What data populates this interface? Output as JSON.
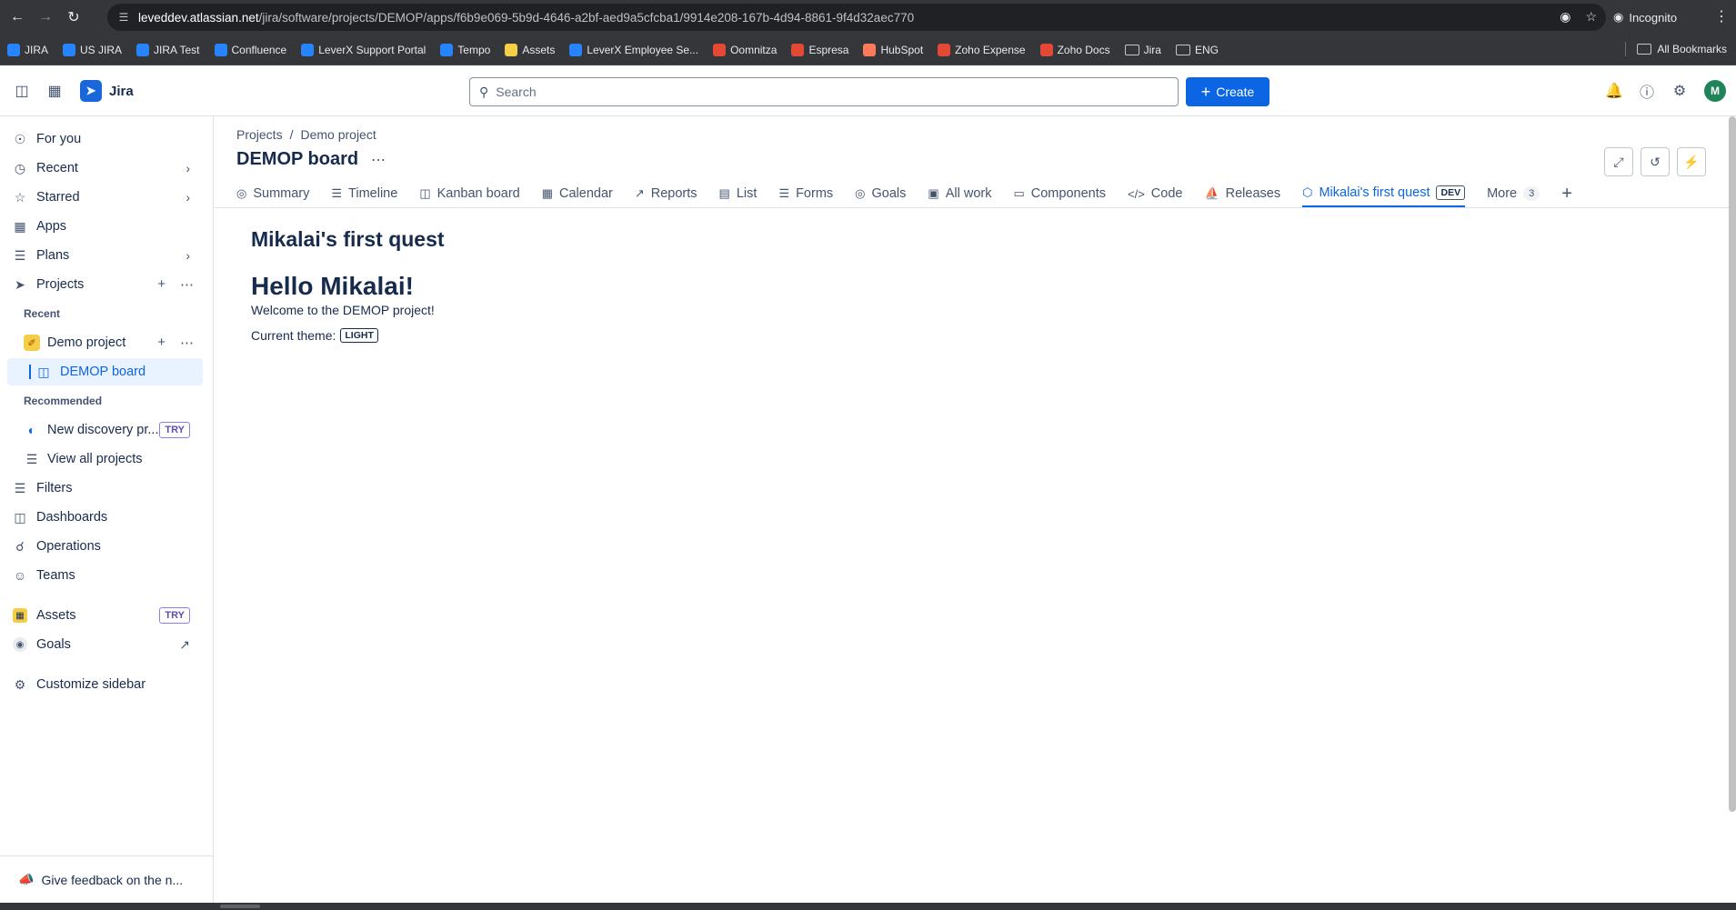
{
  "browser": {
    "url_host": "leveddev.atlassian.net",
    "url_path": "/jira/software/projects/DEMOP/apps/f6b9e069-5b9d-4646-a2bf-aed9a5cfcba1/9914e208-167b-4d94-8861-9f4d32aec770",
    "incognito_label": "Incognito",
    "bookmarks": [
      {
        "label": "JIRA",
        "color": "#2684ff"
      },
      {
        "label": "US JIRA",
        "color": "#2684ff"
      },
      {
        "label": "JIRA Test",
        "color": "#2684ff"
      },
      {
        "label": "Confluence",
        "color": "#2684ff"
      },
      {
        "label": "LeverX Support Portal",
        "color": "#2684ff"
      },
      {
        "label": "Tempo",
        "color": "#2684ff"
      },
      {
        "label": "Assets",
        "color": "#f5cd47"
      },
      {
        "label": "LeverX Employee Se...",
        "color": "#2684ff"
      },
      {
        "label": "Oomnitza",
        "color": "#e34935"
      },
      {
        "label": "Espresa",
        "color": "#e34935"
      },
      {
        "label": "HubSpot",
        "color": "#ff7a59"
      },
      {
        "label": "Zoho Expense",
        "color": "#e34935"
      },
      {
        "label": "Zoho Docs",
        "color": "#e34935"
      }
    ],
    "bookmark_folders": [
      "Jira",
      "ENG"
    ],
    "all_bookmarks_label": "All Bookmarks"
  },
  "topnav": {
    "product_name": "Jira",
    "search_placeholder": "Search",
    "create_label": "Create",
    "avatar_initial": "M"
  },
  "sidebar": {
    "items_top": [
      {
        "label": "For you",
        "icon": "user-circle-icon"
      },
      {
        "label": "Recent",
        "icon": "clock-icon"
      },
      {
        "label": "Starred",
        "icon": "star-icon"
      },
      {
        "label": "Apps",
        "icon": "apps-icon"
      },
      {
        "label": "Plans",
        "icon": "plans-icon"
      },
      {
        "label": "Projects",
        "icon": "rocket-icon"
      }
    ],
    "recent_header": "Recent",
    "project_name": "Demo project",
    "board_name": "DEMOP board",
    "recommended_header": "Recommended",
    "recommended_item": "New discovery pr...",
    "try_badge": "TRY",
    "view_all_projects": "View all projects",
    "items_bottom": [
      {
        "label": "Filters",
        "icon": "filter-icon"
      },
      {
        "label": "Dashboards",
        "icon": "dashboard-icon"
      },
      {
        "label": "Operations",
        "icon": "operations-icon"
      },
      {
        "label": "Teams",
        "icon": "teams-icon"
      }
    ],
    "assets_label": "Assets",
    "goals_label": "Goals",
    "customize_label": "Customize sidebar",
    "feedback_label": "Give feedback on the n..."
  },
  "main": {
    "breadcrumb": [
      "Projects",
      "/",
      "Demo project"
    ],
    "title": "DEMOP board",
    "tabs": [
      {
        "label": "Summary",
        "icon": "globe-icon"
      },
      {
        "label": "Timeline",
        "icon": "timeline-icon"
      },
      {
        "label": "Kanban board",
        "icon": "board-icon"
      },
      {
        "label": "Calendar",
        "icon": "calendar-icon"
      },
      {
        "label": "Reports",
        "icon": "chart-icon"
      },
      {
        "label": "List",
        "icon": "list-icon"
      },
      {
        "label": "Forms",
        "icon": "forms-icon"
      },
      {
        "label": "Goals",
        "icon": "goal-icon"
      },
      {
        "label": "All work",
        "icon": "work-icon"
      },
      {
        "label": "Components",
        "icon": "component-icon"
      },
      {
        "label": "Code",
        "icon": "code-icon"
      },
      {
        "label": "Releases",
        "icon": "ship-icon"
      }
    ],
    "active_tab": {
      "label": "Mikalai's first quest",
      "badge": "DEV"
    },
    "more_label": "More",
    "more_count": "3"
  },
  "app": {
    "title": "Mikalai's first quest",
    "hello": "Hello Mikalai!",
    "welcome": "Welcome to the DEMOP project!",
    "theme_label": "Current theme:",
    "theme_value": "LIGHT"
  }
}
